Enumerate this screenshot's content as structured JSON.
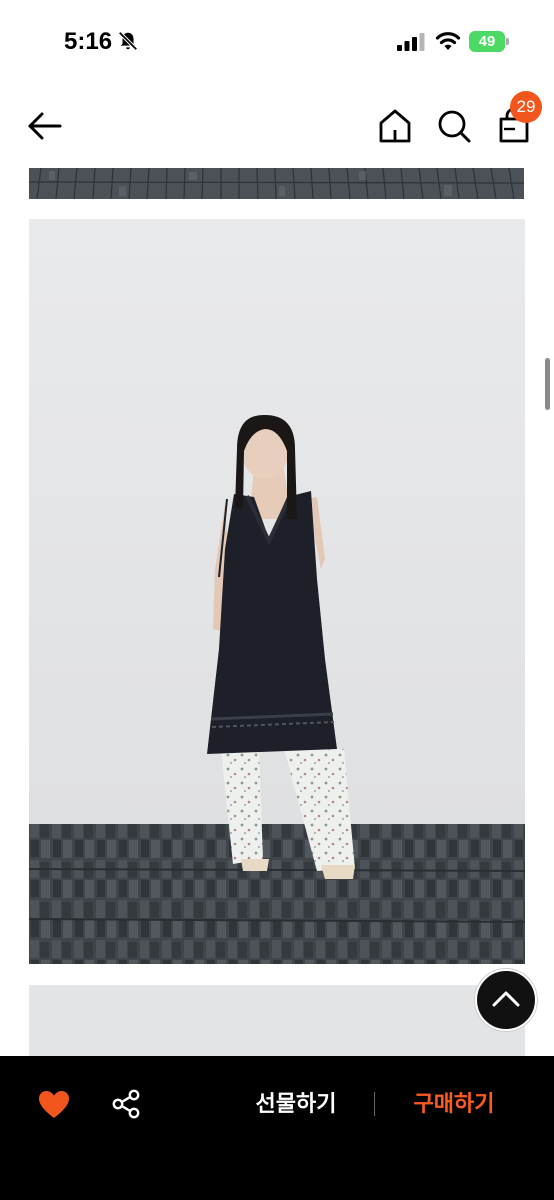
{
  "status_bar": {
    "time": "5:16",
    "battery": "49",
    "icons": [
      "bell-slash-icon",
      "cellular-signal-icon",
      "wifi-icon",
      "battery-icon"
    ]
  },
  "nav": {
    "icons": [
      "arrow-left-icon",
      "home-icon",
      "search-icon",
      "shopping-bag-icon"
    ],
    "cart_count": "29"
  },
  "gallery": {
    "images": [
      "floor-tiles-crop",
      "model-black-dress-floral-pants",
      "next-image-crop"
    ]
  },
  "floating": {
    "icon": "chevron-up-icon"
  },
  "bottom_bar": {
    "heart_icon": "heart-icon",
    "share_icon": "share-icon",
    "gift_label": "선물하기",
    "buy_label": "구매하기",
    "colors": {
      "heart": "#f2561d",
      "buy": "#ff5a1f",
      "bar": "#000000"
    }
  }
}
